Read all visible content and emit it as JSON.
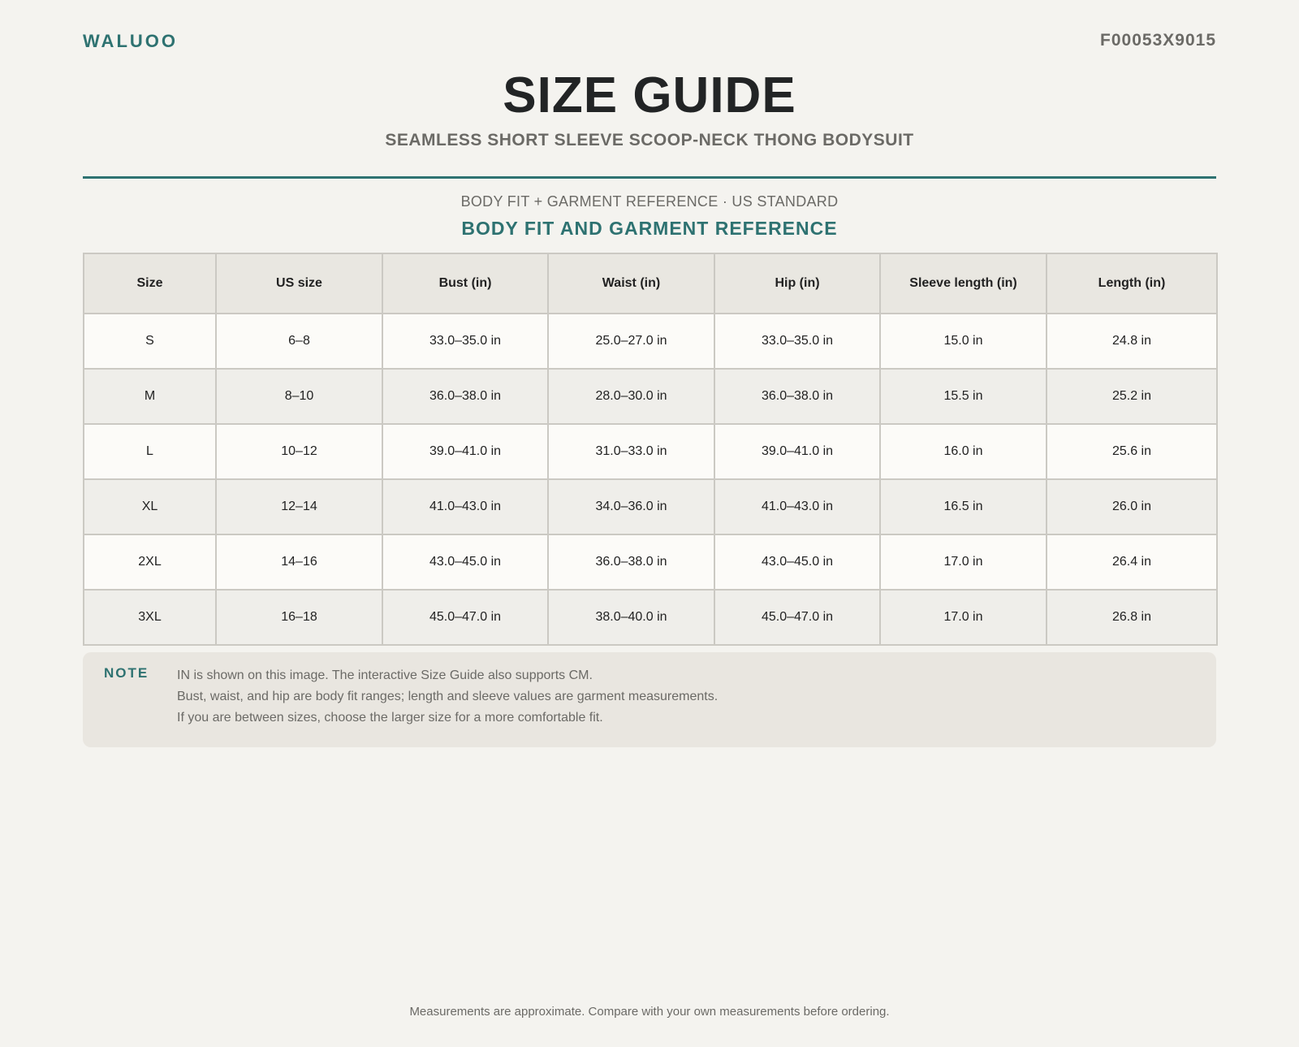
{
  "header": {
    "brand": "WALUOO",
    "sku": "F00053X9015",
    "title": "SIZE GUIDE",
    "subtitle": "SEAMLESS SHORT SLEEVE SCOOP-NECK THONG BODYSUIT"
  },
  "section": {
    "kicker": "BODY FIT + GARMENT REFERENCE · US STANDARD",
    "title": "BODY FIT AND GARMENT REFERENCE"
  },
  "table": {
    "columns": [
      "Size",
      "US size",
      "Bust (in)",
      "Waist (in)",
      "Hip (in)",
      "Sleeve length (in)",
      "Length (in)"
    ],
    "rows": [
      [
        "S",
        "6–8",
        "33.0–35.0 in",
        "25.0–27.0 in",
        "33.0–35.0 in",
        "15.0 in",
        "24.8 in"
      ],
      [
        "M",
        "8–10",
        "36.0–38.0 in",
        "28.0–30.0 in",
        "36.0–38.0 in",
        "15.5 in",
        "25.2 in"
      ],
      [
        "L",
        "10–12",
        "39.0–41.0 in",
        "31.0–33.0 in",
        "39.0–41.0 in",
        "16.0 in",
        "25.6 in"
      ],
      [
        "XL",
        "12–14",
        "41.0–43.0 in",
        "34.0–36.0 in",
        "41.0–43.0 in",
        "16.5 in",
        "26.0 in"
      ],
      [
        "2XL",
        "14–16",
        "43.0–45.0 in",
        "36.0–38.0 in",
        "43.0–45.0 in",
        "17.0 in",
        "26.4 in"
      ],
      [
        "3XL",
        "16–18",
        "45.0–47.0 in",
        "38.0–40.0 in",
        "45.0–47.0 in",
        "17.0 in",
        "26.8 in"
      ]
    ]
  },
  "note": {
    "label": "NOTE",
    "lines": [
      "IN is shown on this image. The interactive Size Guide also supports CM.",
      "Bust, waist, and hip are body fit ranges; length and sleeve values are garment measurements.",
      "If you are between sizes, choose the larger size for a more comfortable fit."
    ]
  },
  "footer": {
    "text": "Measurements are approximate. Compare with your own measurements before ordering."
  },
  "colors": {
    "accent": "#2e7271",
    "background": "#f4f3ef",
    "muted_text": "#6b6a66"
  }
}
